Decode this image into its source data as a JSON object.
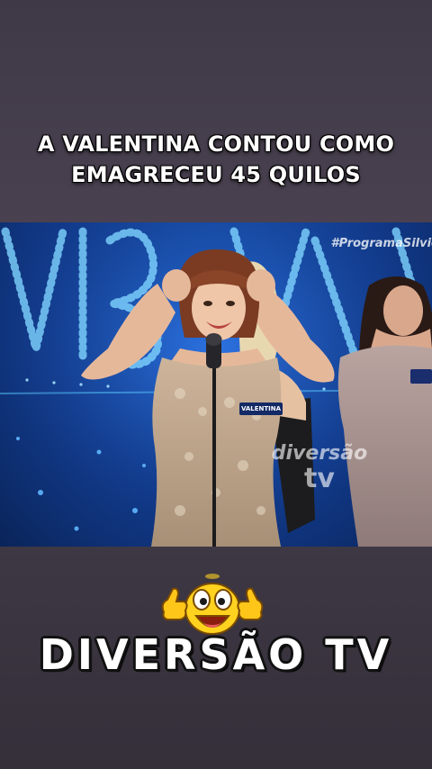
{
  "headline": {
    "line1": "A VALENTINA CONTOU COMO",
    "line2": "EMAGRECEU 45 QUILOS"
  },
  "video": {
    "hashtag": "#ProgramaSilvio",
    "name_tag": "VALENTINA",
    "watermark_line1": "diversão",
    "watermark_line2": "tv"
  },
  "brand": {
    "title": "DIVERSÃO TV",
    "emoji": "laughing-thumbs-up-emoji"
  },
  "colors": {
    "background": "#3f3947",
    "studio_blue": "#1d5fc6",
    "text": "#ffffff"
  }
}
